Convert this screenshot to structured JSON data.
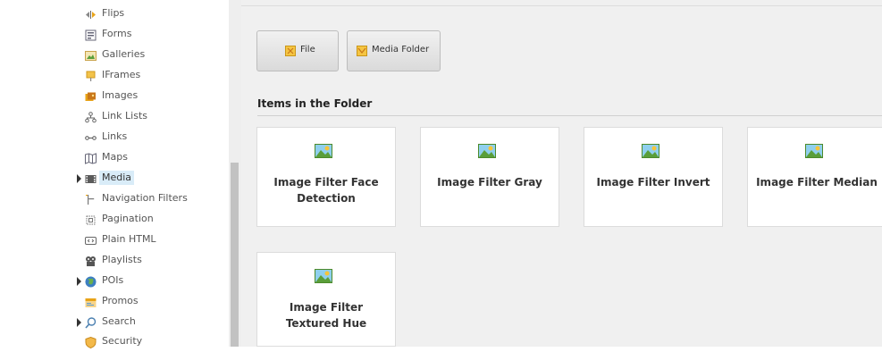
{
  "sidebar": {
    "items": [
      {
        "label": "Flips",
        "icon": "flip-icon",
        "expandable": false,
        "selected": false
      },
      {
        "label": "Forms",
        "icon": "form-icon",
        "expandable": false,
        "selected": false
      },
      {
        "label": "Galleries",
        "icon": "gallery-icon",
        "expandable": false,
        "selected": false
      },
      {
        "label": "IFrames",
        "icon": "iframe-icon",
        "expandable": false,
        "selected": false
      },
      {
        "label": "Images",
        "icon": "images-icon",
        "expandable": false,
        "selected": false
      },
      {
        "label": "Link Lists",
        "icon": "link-list-icon",
        "expandable": false,
        "selected": false
      },
      {
        "label": "Links",
        "icon": "link-icon",
        "expandable": false,
        "selected": false
      },
      {
        "label": "Maps",
        "icon": "map-icon",
        "expandable": false,
        "selected": false
      },
      {
        "label": "Media",
        "icon": "media-icon",
        "expandable": true,
        "selected": true
      },
      {
        "label": "Navigation Filters",
        "icon": "navigation-filter-icon",
        "expandable": false,
        "selected": false
      },
      {
        "label": "Pagination",
        "icon": "pagination-icon",
        "expandable": false,
        "selected": false
      },
      {
        "label": "Plain HTML",
        "icon": "plain-html-icon",
        "expandable": false,
        "selected": false
      },
      {
        "label": "Playlists",
        "icon": "playlist-icon",
        "expandable": false,
        "selected": false
      },
      {
        "label": "POIs",
        "icon": "globe-icon",
        "expandable": true,
        "selected": false
      },
      {
        "label": "Promos",
        "icon": "promo-icon",
        "expandable": false,
        "selected": false
      },
      {
        "label": "Search",
        "icon": "search-icon",
        "expandable": true,
        "selected": false
      },
      {
        "label": "Security",
        "icon": "shield-icon",
        "expandable": false,
        "selected": false
      }
    ]
  },
  "insert_options": [
    {
      "label": "File",
      "icon": "file-icon"
    },
    {
      "label": "Media Folder",
      "icon": "media-folder-icon"
    }
  ],
  "folder": {
    "title": "Items in the Folder",
    "items": [
      {
        "label": "Image Filter Face Detection",
        "icon": "image-thumbnail-icon"
      },
      {
        "label": "Image Filter Gray",
        "icon": "image-thumbnail-icon"
      },
      {
        "label": "Image Filter Invert",
        "icon": "image-thumbnail-icon"
      },
      {
        "label": "Image Filter Median",
        "icon": "image-thumbnail-icon"
      },
      {
        "label": "Image Filter Textured Hue",
        "icon": "image-thumbnail-icon"
      }
    ]
  },
  "colors": {
    "selected_bg": "#d9ecf8",
    "content_bg": "#f0f0f0",
    "icon_gold": "#e8a317",
    "icon_green": "#5a9e3a",
    "icon_blue": "#5b9bd5"
  }
}
